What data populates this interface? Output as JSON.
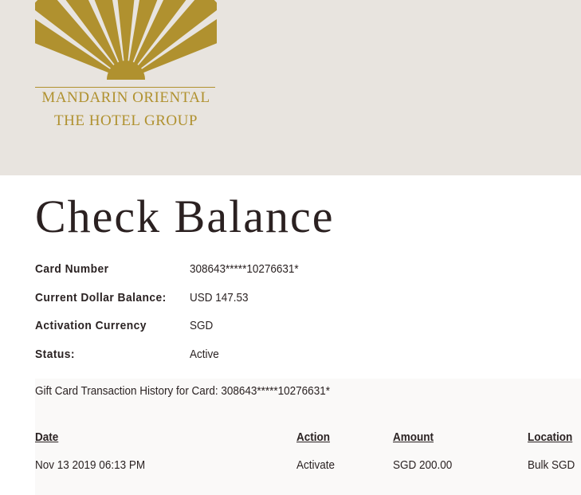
{
  "brand": {
    "line1": "MANDARIN ORIENTAL",
    "line2": "THE HOTEL GROUP",
    "color": "#b0912f",
    "header_bg": "#e8e4df"
  },
  "page": {
    "title": "Check Balance"
  },
  "card_info": {
    "card_number_label": "Card Number",
    "card_number_value": "308643*****10276631*",
    "balance_label": "Current Dollar Balance:",
    "balance_value": "USD 147.53",
    "currency_label": "Activation Currency",
    "currency_value": "SGD",
    "status_label": "Status:",
    "status_value": "Active"
  },
  "history": {
    "title": "Gift Card Transaction History for Card: 308643*****10276631*",
    "columns": {
      "date": "Date",
      "action": "Action",
      "amount": "Amount",
      "location": "Location"
    },
    "rows": [
      {
        "date": "Nov 13 2019 06:13 PM",
        "action": "Activate",
        "amount": "SGD 200.00",
        "location": "Bulk SGD"
      }
    ]
  }
}
